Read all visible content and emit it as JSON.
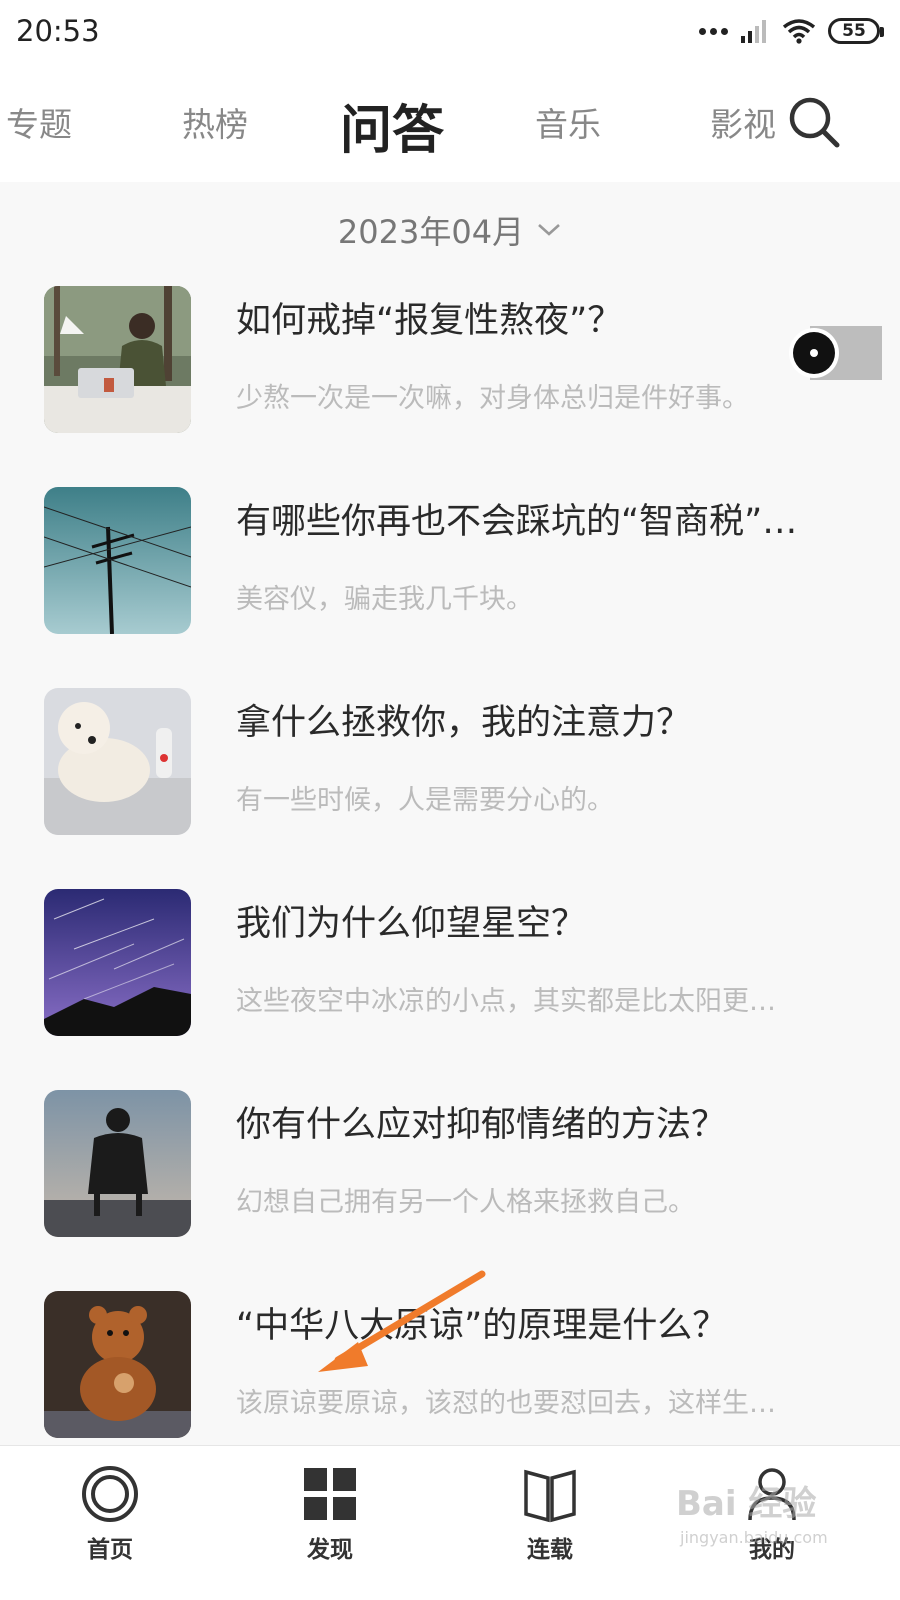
{
  "status_bar": {
    "time": "20:53",
    "battery": "55"
  },
  "tabs": [
    {
      "label": "专题"
    },
    {
      "label": "热榜"
    },
    {
      "label": "问答",
      "active": true
    },
    {
      "label": "音乐"
    },
    {
      "label": "影视"
    }
  ],
  "month_selector": {
    "label": "2023年04月",
    "icon": "chevron-down-icon"
  },
  "items": [
    {
      "title": "如何戒掉“报复性熬夜”？",
      "subtitle": "少熬一次是一次嘛，对身体总归是件好事。"
    },
    {
      "title": "有哪些你再也不会踩坑的“智商税”…",
      "subtitle": "美容仪，骗走我几千块。"
    },
    {
      "title": "拿什么拯救你，我的注意力？",
      "subtitle": "有一些时候，人是需要分心的。"
    },
    {
      "title": "我们为什么仰望星空？",
      "subtitle": "这些夜空中冰凉的小点，其实都是比太阳更…"
    },
    {
      "title": "你有什么应对抑郁情绪的方法？",
      "subtitle": "幻想自己拥有另一个人格来拯救自己。"
    },
    {
      "title": "“中华八大原谅”的原理是什么？",
      "subtitle": "该原谅要原谅，该怼的也要怼回去，这样生…"
    }
  ],
  "bottom_nav": [
    {
      "label": "首页",
      "icon": "home-circle-icon"
    },
    {
      "label": "发现",
      "icon": "grid-icon",
      "active": true
    },
    {
      "label": "连载",
      "icon": "book-icon"
    },
    {
      "label": "我的",
      "icon": "person-icon"
    }
  ],
  "watermark": {
    "brand": "Bai 经验",
    "site": "jingyan.baidu.com"
  },
  "colors": {
    "annotation_arrow": "#f07b2b",
    "background": "#f8f8f8"
  }
}
